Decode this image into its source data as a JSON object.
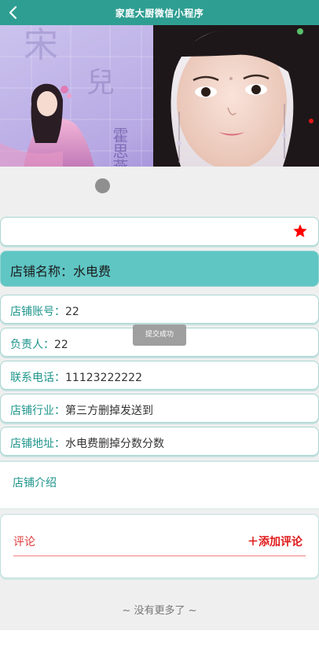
{
  "navbar": {
    "title": "家庭大厨微信小程序",
    "back_icon": "chevron-left-icon"
  },
  "banner": {
    "calligraphy": [
      "宋",
      "兒"
    ],
    "caption": "霍思燕"
  },
  "favorite": {
    "icon": "star-icon",
    "color": "#ff0000"
  },
  "shop": {
    "name_label": "店铺名称：",
    "name_value": "水电费",
    "account_label": "店铺账号：",
    "account_value": "22",
    "owner_label": "负责人：",
    "owner_value": "22",
    "phone_label": "联系电话：",
    "phone_value": "11123222222",
    "industry_label": "店铺行业：",
    "industry_value": "第三方删掉发送到",
    "address_label": "店铺地址：",
    "address_value": "水电费删掉分数分数",
    "intro_label": "店铺介绍"
  },
  "comments": {
    "title": "评论",
    "add_label": "＋添加评论"
  },
  "footer": {
    "no_more": "~ 没有更多了 ~"
  },
  "toast": {
    "text": "提交成功"
  },
  "colors": {
    "primary": "#2f9e92",
    "name_bar": "#5fc6c4",
    "accent_red": "#e01818"
  }
}
